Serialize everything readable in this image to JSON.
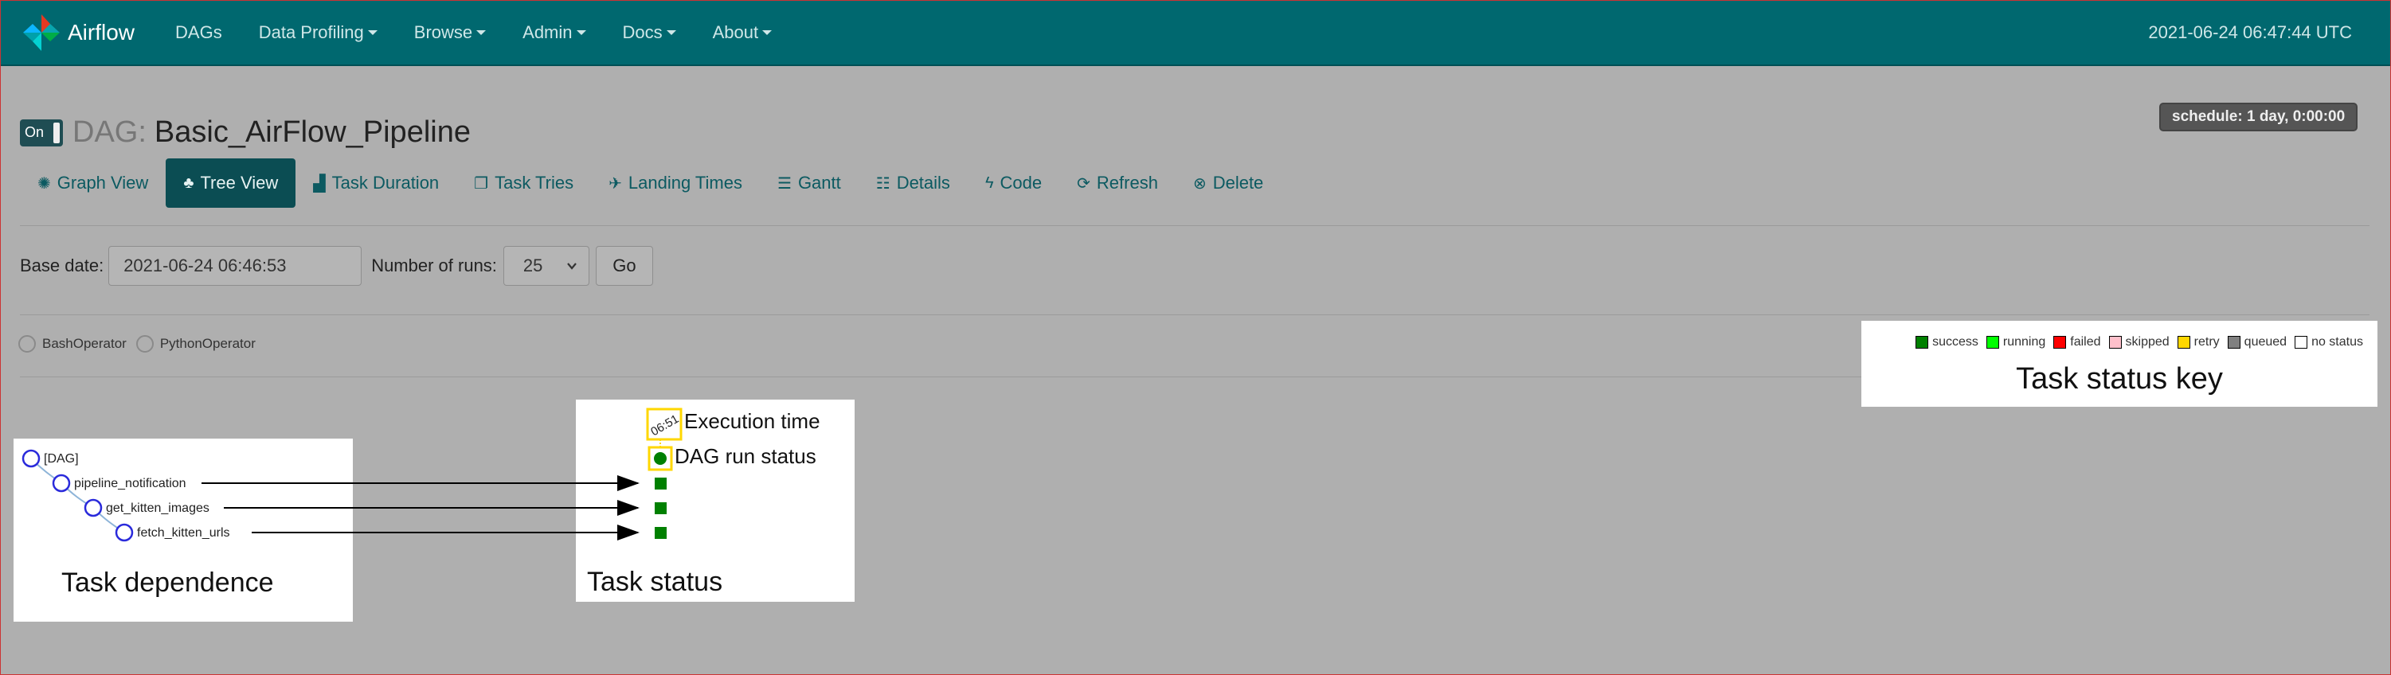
{
  "navbar": {
    "brand": "Airflow",
    "items": [
      {
        "label": "DAGs",
        "dropdown": false
      },
      {
        "label": "Data Profiling",
        "dropdown": true
      },
      {
        "label": "Browse",
        "dropdown": true
      },
      {
        "label": "Admin",
        "dropdown": true
      },
      {
        "label": "Docs",
        "dropdown": true
      },
      {
        "label": "About",
        "dropdown": true
      }
    ],
    "clock": "2021-06-24 06:47:44 UTC"
  },
  "dag": {
    "toggle_label": "On",
    "prefix": "DAG:",
    "name": "Basic_AirFlow_Pipeline",
    "schedule": "schedule: 1 day, 0:00:00"
  },
  "tabs": [
    {
      "label": "Graph View",
      "icon": "asterisk-icon",
      "glyph": "✺",
      "active": false
    },
    {
      "label": "Tree View",
      "icon": "tree-icon",
      "glyph": "♣",
      "active": true
    },
    {
      "label": "Task Duration",
      "icon": "bar-chart-icon",
      "glyph": "▟",
      "active": false
    },
    {
      "label": "Task Tries",
      "icon": "duplicate-icon",
      "glyph": "❐",
      "active": false
    },
    {
      "label": "Landing Times",
      "icon": "plane-icon",
      "glyph": "✈",
      "active": false
    },
    {
      "label": "Gantt",
      "icon": "align-left-icon",
      "glyph": "☰",
      "active": false
    },
    {
      "label": "Details",
      "icon": "list-icon",
      "glyph": "☷",
      "active": false
    },
    {
      "label": "Code",
      "icon": "flash-icon",
      "glyph": "ϟ",
      "active": false
    },
    {
      "label": "Refresh",
      "icon": "refresh-icon",
      "glyph": "⟳",
      "active": false
    },
    {
      "label": "Delete",
      "icon": "remove-circle-icon",
      "glyph": "⊗",
      "active": false
    }
  ],
  "form": {
    "base_date_label": "Base date:",
    "base_date_value": "2021-06-24 06:46:53",
    "runs_label": "Number of runs:",
    "runs_value": "25",
    "go_label": "Go"
  },
  "operators": [
    {
      "label": "BashOperator"
    },
    {
      "label": "PythonOperator"
    }
  ],
  "status_key": {
    "caption": "Task status key",
    "items": [
      {
        "label": "success",
        "color": "#008000"
      },
      {
        "label": "running",
        "color": "#00ff00"
      },
      {
        "label": "failed",
        "color": "#ff0000"
      },
      {
        "label": "skipped",
        "color": "#ffc0cb"
      },
      {
        "label": "retry",
        "color": "#ffd700"
      },
      {
        "label": "queued",
        "color": "#808080"
      },
      {
        "label": "no status",
        "color": "#ffffff"
      }
    ]
  },
  "tree": {
    "caption": "Task dependence",
    "nodes": [
      "[DAG]",
      "pipeline_notification",
      "get_kitten_images",
      "fetch_kitten_urls"
    ]
  },
  "task_status": {
    "caption": "Task status",
    "execution_label": "Execution time",
    "dag_run_label": "DAG run status",
    "run_tick": "06:51"
  },
  "colors": {
    "navbar": "#00686f",
    "success": "#008000",
    "highlight": "#ffd700",
    "tree_node": "#2a2adb"
  }
}
